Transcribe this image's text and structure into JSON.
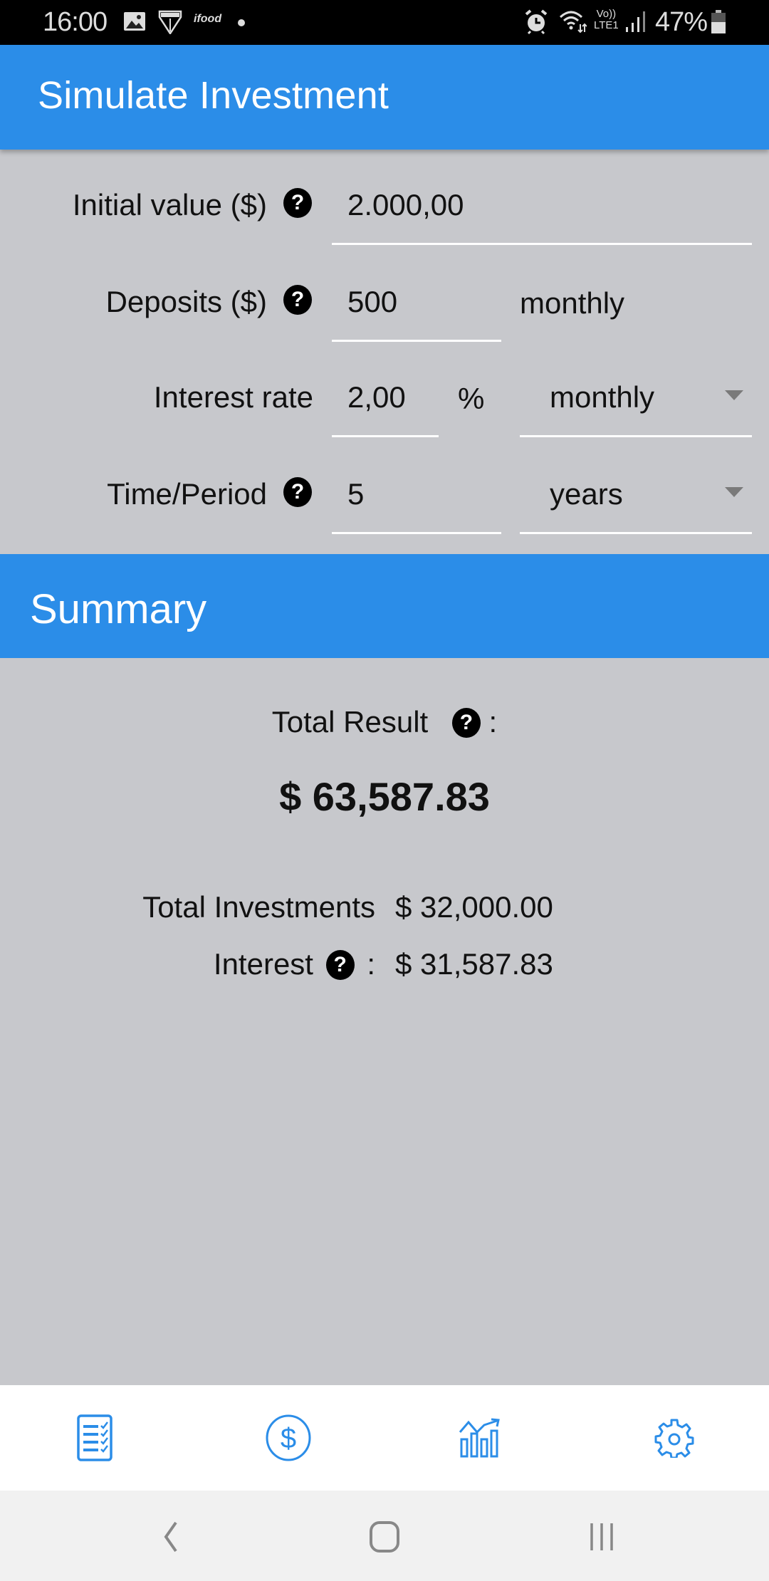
{
  "status_bar": {
    "time": "16:00",
    "left_icons": [
      "gallery-icon",
      "spfc-icon",
      "ifood-icon",
      "dot-icon"
    ],
    "right_icons": [
      "alarm-icon",
      "wifi-icon",
      "volte-lte-icon",
      "signal-icon",
      "battery-icon"
    ],
    "battery": "47%",
    "network": "LTE1",
    "volte": "Vo))"
  },
  "app_bar": {
    "title": "Simulate Investment"
  },
  "form": {
    "initial_value": {
      "label": "Initial value ($)",
      "help": "?",
      "value": "2.000,00"
    },
    "deposits": {
      "label": "Deposits ($)",
      "help": "?",
      "value": "500",
      "frequency": "monthly"
    },
    "interest_rate": {
      "label": "Interest rate",
      "value": "2,00",
      "unit": "%",
      "period_selected": "monthly"
    },
    "time_period": {
      "label": "Time/Period",
      "help": "?",
      "value": "5",
      "unit_selected": "years"
    }
  },
  "summary": {
    "title": "Summary",
    "total_result_label": "Total Result",
    "total_result_help": "?",
    "colon": ":",
    "total_result_value": "$ 63,587.83",
    "total_investments_label": "Total Investments",
    "total_investments_value": "$ 32,000.00",
    "interest_label": "Interest",
    "interest_help": "?",
    "interest_value": "$ 31,587.83"
  },
  "bottom_nav": {
    "items": [
      {
        "icon": "checklist-icon",
        "name": "nav-checklist"
      },
      {
        "icon": "dollar-circle-icon",
        "name": "nav-simulate"
      },
      {
        "icon": "chart-growth-icon",
        "name": "nav-chart"
      },
      {
        "icon": "gear-icon",
        "name": "nav-settings"
      }
    ]
  },
  "colors": {
    "primary": "#2b8de8",
    "background": "#c7c8cc",
    "nav_background": "#ffffff",
    "system_nav": "#f1f1f1"
  }
}
